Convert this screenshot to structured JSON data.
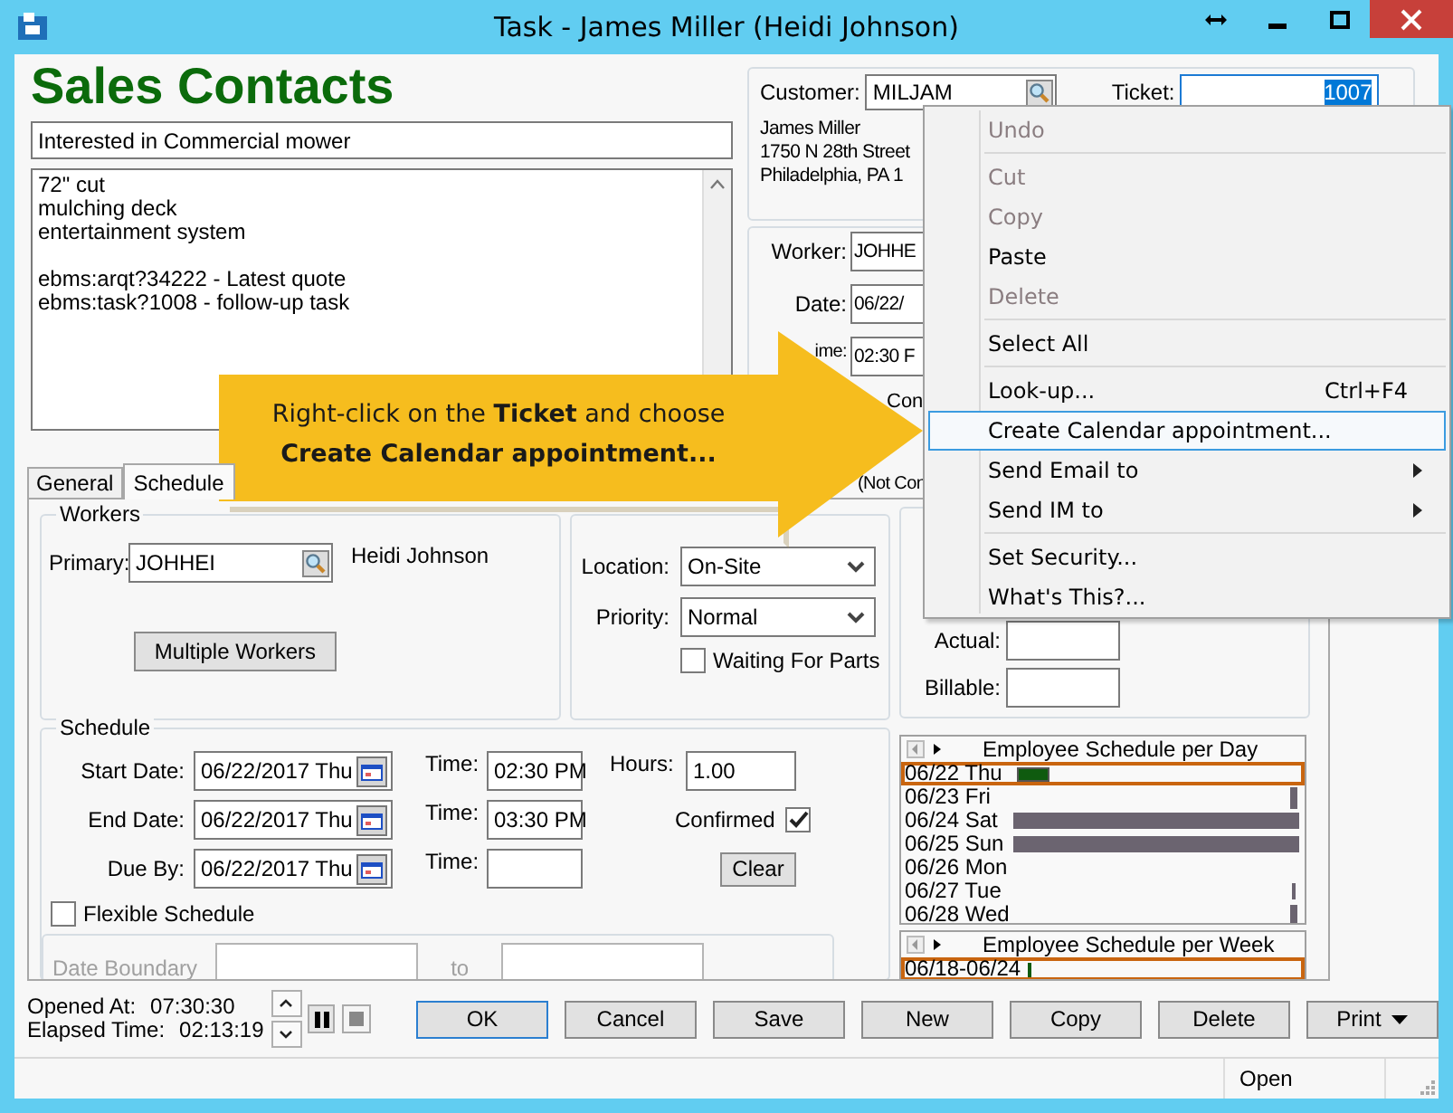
{
  "window": {
    "title": "Task - James Miller (Heidi Johnson)"
  },
  "heading": "Sales Contacts",
  "subject": "Interested in Commercial mower",
  "notes": [
    [
      "72\" cut",
      "mulching deck",
      "entertainment system"
    ],
    [
      "ebms:arqt?34222 - Latest quote",
      "ebms:task?1008 - follow-up task"
    ]
  ],
  "customer": {
    "label": "Customer:",
    "value": "MILJAM",
    "ticket_label": "Ticket:",
    "ticket": "1007",
    "address": [
      "James Miller",
      "1750 N 28th Street",
      "Philadelphia, PA 1"
    ]
  },
  "assignment": {
    "worker_label": "Worker:",
    "worker": "JOHHE",
    "date_label": "Date:",
    "date": "06/22/",
    "time_label": "ime:",
    "time": "02:30 F",
    "confirmed_label": "Con",
    "status": "(Not Con"
  },
  "tabs": [
    {
      "label": "General",
      "selected": false
    },
    {
      "label": "Schedule",
      "selected": true
    }
  ],
  "workers": {
    "title": "Workers",
    "primary_label": "Primary:",
    "primary": "JOHHEI",
    "name": "Heidi Johnson",
    "button": "Multiple Workers"
  },
  "options": {
    "location_label": "Location:",
    "location": "On-Site",
    "priority_label": "Priority:",
    "priority": "Normal",
    "waiting_label": "Waiting For Parts",
    "waiting": false
  },
  "hours": {
    "actual_label": "Actual:",
    "billable_label": "Billable:"
  },
  "schedule": {
    "title": "Schedule",
    "rows": [
      {
        "label": "Start Date:",
        "date": "06/22/2017 Thu",
        "time_label": "Time:",
        "time": "02:30 PM"
      },
      {
        "label": "End Date:",
        "date": "06/22/2017 Thu",
        "time_label": "Time:",
        "time": "03:30 PM"
      },
      {
        "label": "Due By:",
        "date": "06/22/2017 Thu",
        "time_label": "Time:"
      }
    ],
    "hours_label": "Hours:",
    "hours": "1.00",
    "confirmed_label": "Confirmed",
    "confirmed": true,
    "clear": "Clear",
    "flexible_label": "Flexible Schedule",
    "flexible": false,
    "boundary_label": "Date Boundary",
    "to_label": "to",
    "boundary_disabled": true
  },
  "day_schedule": {
    "title": "Employee Schedule per Day",
    "days": [
      {
        "label": "06/22 Thu",
        "selected": true,
        "kind": "booked"
      },
      {
        "label": "06/23 Fri",
        "selected": false,
        "kind": "edge"
      },
      {
        "label": "06/24 Sat",
        "selected": false,
        "kind": "full"
      },
      {
        "label": "06/25 Sun",
        "selected": false,
        "kind": "full"
      },
      {
        "label": "06/26 Mon",
        "selected": false,
        "kind": "empty"
      },
      {
        "label": "06/27 Tue",
        "selected": false,
        "kind": "thin"
      },
      {
        "label": "06/28 Wed",
        "selected": false,
        "kind": "edge"
      }
    ]
  },
  "week_schedule": {
    "title": "Employee Schedule per Week",
    "weeks": [
      {
        "label": "06/18-06/24",
        "selected": true
      }
    ]
  },
  "footer": {
    "opened_label": "Opened At:",
    "opened": "07:30:30",
    "elapsed_label": "Elapsed Time:",
    "elapsed": "02:13:19"
  },
  "buttons": [
    {
      "label": "OK",
      "kind": "default"
    },
    {
      "label": "Cancel",
      "kind": "plain"
    },
    {
      "label": "Save",
      "kind": "plain"
    },
    {
      "label": "New",
      "kind": "plain"
    },
    {
      "label": "Copy",
      "kind": "plain"
    },
    {
      "label": "Delete",
      "kind": "plain"
    },
    {
      "label": "Print",
      "kind": "menu"
    }
  ],
  "status_bar": {
    "text": "Open"
  },
  "context_menu": [
    {
      "kind": "item",
      "label": "Undo",
      "disabled": true,
      "selected": false
    },
    {
      "kind": "separator"
    },
    {
      "kind": "item",
      "label": "Cut",
      "disabled": true,
      "selected": false
    },
    {
      "kind": "item",
      "label": "Copy",
      "disabled": true,
      "selected": false
    },
    {
      "kind": "item",
      "label": "Paste",
      "disabled": false,
      "selected": false
    },
    {
      "kind": "item",
      "label": "Delete",
      "disabled": true,
      "selected": false
    },
    {
      "kind": "separator"
    },
    {
      "kind": "item",
      "label": "Select All",
      "disabled": false,
      "selected": false
    },
    {
      "kind": "separator"
    },
    {
      "kind": "item",
      "label": "Look-up...",
      "shortcut": "Ctrl+F4",
      "disabled": false,
      "selected": false
    },
    {
      "kind": "item",
      "label": "Create Calendar appointment...",
      "disabled": false,
      "selected": true
    },
    {
      "kind": "submenu",
      "label": "Send Email to",
      "disabled": false,
      "selected": false
    },
    {
      "kind": "submenu",
      "label": "Send IM to",
      "disabled": false,
      "selected": false
    },
    {
      "kind": "separator"
    },
    {
      "kind": "item",
      "label": "Set Security...",
      "disabled": false,
      "selected": false
    },
    {
      "kind": "item",
      "label": "What's This?...",
      "disabled": false,
      "selected": false
    }
  ],
  "callout": {
    "text": "Right-click on the **Ticket** and choose",
    "emphasis": "Create Calendar appointment..."
  }
}
